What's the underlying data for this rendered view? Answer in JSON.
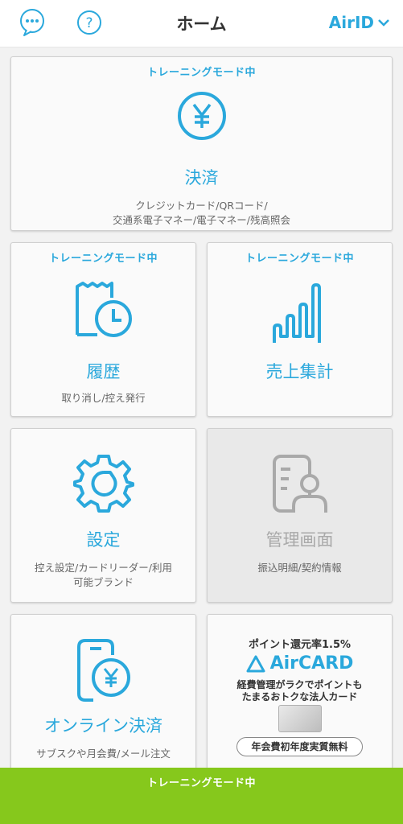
{
  "header": {
    "title": "ホーム",
    "account_label": "AirID"
  },
  "training_badge": "トレーニングモード中",
  "tiles": {
    "payment": {
      "title": "決済",
      "sub1": "クレジットカード/QRコード/",
      "sub2": "交通系電子マネー/電子マネー/残高照会"
    },
    "history": {
      "title": "履歴",
      "sub1": "取り消し/控え発行"
    },
    "sales": {
      "title": "売上集計"
    },
    "settings": {
      "title": "設定",
      "sub1": "控え設定/カードリーダー/利用",
      "sub2": "可能ブランド"
    },
    "admin": {
      "title": "管理画面",
      "sub1": "振込明細/契約情報"
    },
    "online": {
      "title": "オンライン決済",
      "sub1": "サブスクや月会費/メール注文"
    }
  },
  "promo": {
    "headline": "ポイント還元率1.5%",
    "brand": "AirCARD",
    "desc1": "経費管理がラクでポイントも",
    "desc2": "たまるおトクな法人カード",
    "pill": "年会費初年度実質無料"
  },
  "bottom_bar": {
    "label": "トレーニングモード中"
  },
  "colors": {
    "accent": "#2aa8dc",
    "training_bar": "#86c81c",
    "disabled_text": "#a9a9a9"
  }
}
